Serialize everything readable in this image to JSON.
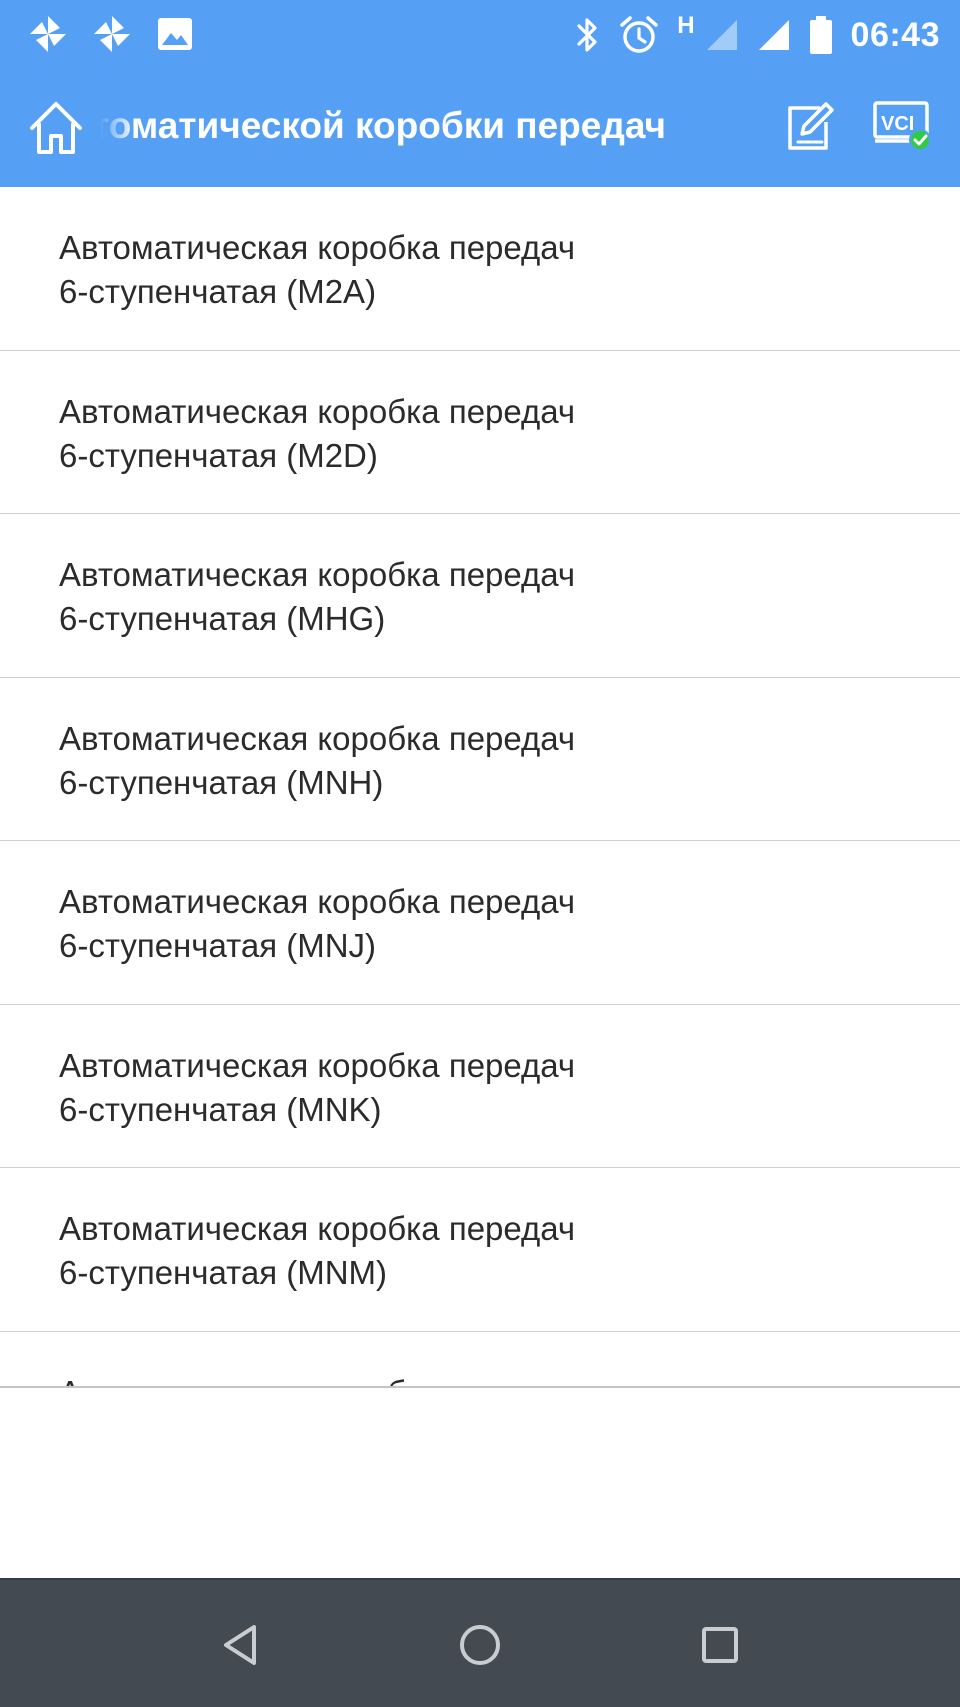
{
  "status_bar": {
    "time": "06:43",
    "network_type": "H",
    "left_icons": [
      "pinwheel-icon",
      "pinwheel-icon",
      "image-icon"
    ],
    "right_icons": [
      "bluetooth-icon",
      "alarm-icon",
      "signal-icon",
      "signal-icon",
      "battery-icon"
    ]
  },
  "app_bar": {
    "title": "Автоматической коробки передач",
    "home_icon": "home-icon",
    "actions": [
      "edit-icon",
      "vci-status-icon"
    ],
    "vci_label": "VCI",
    "vci_status_color": "#2ecc40",
    "color": "#55a0f5"
  },
  "list": {
    "items": [
      {
        "line1": "Автоматическая коробка передач",
        "line2": "6-ступенчатая (M2A)"
      },
      {
        "line1": "Автоматическая коробка передач",
        "line2": "6-ступенчатая (M2D)"
      },
      {
        "line1": "Автоматическая коробка передач",
        "line2": "6-ступенчатая (MHG)"
      },
      {
        "line1": "Автоматическая коробка передач",
        "line2": "6-ступенчатая (MNH)"
      },
      {
        "line1": "Автоматическая коробка передач",
        "line2": "6-ступенчатая (MNJ)"
      },
      {
        "line1": "Автоматическая коробка передач",
        "line2": "6-ступенчатая (MNK)"
      },
      {
        "line1": "Автоматическая коробка передач",
        "line2": "6-ступенчатая (MNM)"
      },
      {
        "line1": "Автоматическая коробка передач",
        "line2": ""
      }
    ]
  },
  "nav_bar": {
    "buttons": [
      "back-icon",
      "home-circle-icon",
      "recents-icon"
    ],
    "color": "#434a51"
  }
}
